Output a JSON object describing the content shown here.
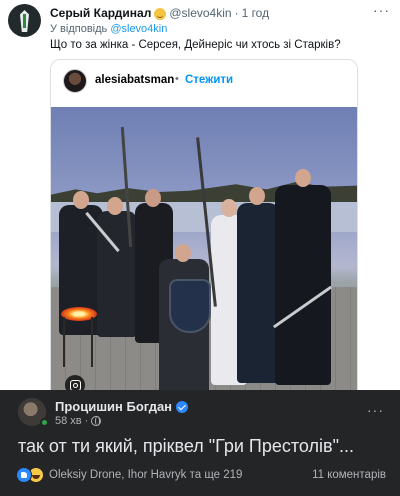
{
  "tweet": {
    "display_name": "Серый Кардинал",
    "handle": "@slevo4kin",
    "dot": "·",
    "time": "1 год",
    "more": "···",
    "reply_prefix": "У відповідь",
    "reply_mention": "@slevo4kin",
    "text": "Що то за жінка - Серсея, Дейнеріс чи хтось зі Старків?"
  },
  "embed": {
    "username": "alesiabatsman",
    "dot": "•",
    "follow_label": "Стежити"
  },
  "comment": {
    "author": "Процишин Богдан",
    "time": "58 хв",
    "dot": "·",
    "more": "···",
    "text": "так от ти який, пріквел \"Гри Престолів\"...",
    "reactions_text": "Oleksiy Drone, Ihor Havryk та ще 219",
    "comments_count": "11 коментарів"
  },
  "colors": {
    "link_blue": "#1d9bf0",
    "instagram_follow": "#0095f6",
    "fb_background": "#242526",
    "fb_verified": "#2d88ff"
  },
  "icons": [
    "tie-avatar",
    "smile-emoji",
    "more-icon",
    "instagram-icon",
    "verified-icon",
    "globe-icon",
    "like-reaction-icon",
    "haha-reaction-icon"
  ]
}
